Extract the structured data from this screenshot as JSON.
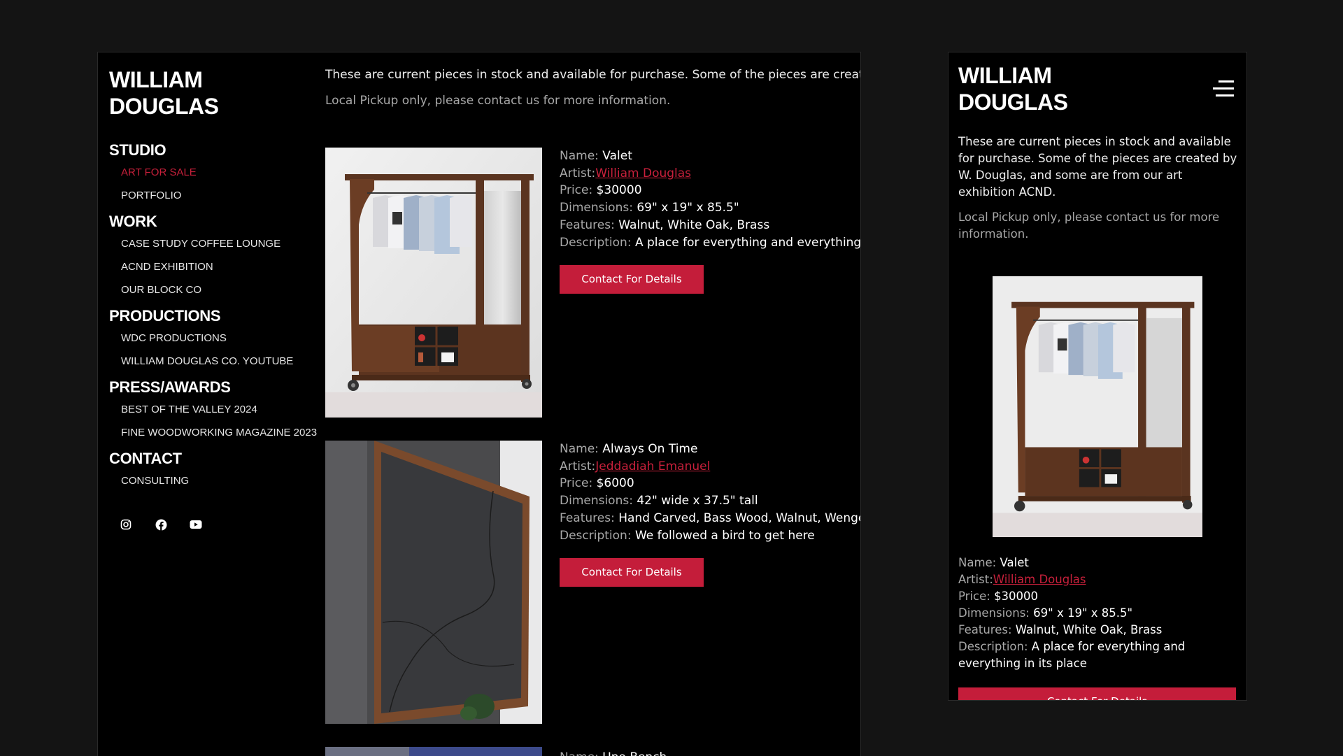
{
  "brand": {
    "line1": "WILLIAM",
    "line2": "DOUGLAS"
  },
  "nav": {
    "studio": {
      "title": "STUDIO",
      "items": [
        "ART FOR SALE",
        "PORTFOLIO"
      ]
    },
    "work": {
      "title": "WORK",
      "items": [
        "CASE STUDY COFFEE LOUNGE",
        "ACND EXHIBITION",
        "OUR BLOCK CO"
      ]
    },
    "productions": {
      "title": "PRODUCTIONS",
      "items": [
        "WDC PRODUCTIONS",
        "WILLIAM DOUGLAS CO. YOUTUBE"
      ]
    },
    "press": {
      "title": "PRESS/AWARDS",
      "items": [
        "BEST OF THE VALLEY 2024",
        "FINE WOODWORKING MAGAZINE 2023"
      ]
    },
    "contact": {
      "title": "CONTACT",
      "items": [
        "CONSULTING"
      ]
    },
    "social_icons": [
      "instagram-icon",
      "facebook-icon",
      "youtube-icon"
    ]
  },
  "intro": "These are current pieces in stock and available for purchase. Some of the pieces are created by W. Douglas, and some are from our art exhibition ACND.",
  "intro_cropped": "These are current pieces in stock and available for purchase. Some of the pieces are created b",
  "pickup": "Local Pickup only, please contact us for more information.",
  "labels": {
    "name": "Name:",
    "artist": "Artist:",
    "price": "Price:",
    "dimensions": "Dimensions:",
    "features": "Features:",
    "description": "Description:",
    "button": "Contact For Details"
  },
  "items": [
    {
      "name": "Valet",
      "artist": "William Douglas",
      "price": "$30000",
      "dimensions": "69\" x 19\" x 85.5\"",
      "features": "Walnut, White Oak, Brass",
      "description": "A place for everything and everything in its place",
      "description_cropped": "A place for everything and everything in"
    },
    {
      "name": "Always On Time",
      "artist": "Jeddadiah Emanuel",
      "price": "$6000",
      "dimensions": "42\" wide x 37.5\" tall",
      "features": "Hand Carved, Bass Wood, Walnut, Wenge,",
      "description": "We followed a bird to get here"
    },
    {
      "name": "Uno Bench"
    }
  ],
  "colors": {
    "accent": "#c41d3a",
    "link": "#c8203b",
    "background": "#000000",
    "page": "#141414"
  },
  "mobile": {
    "menu_icon": "hamburger-icon"
  }
}
